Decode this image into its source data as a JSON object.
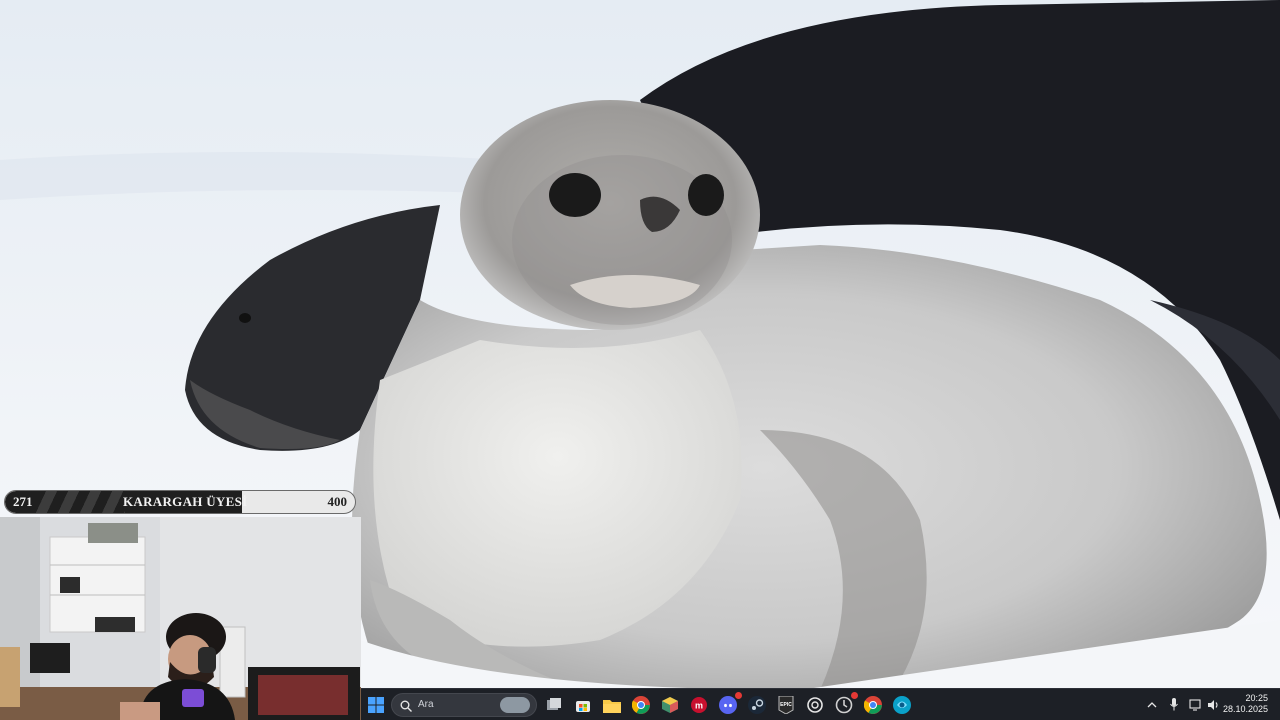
{
  "wallpaper": {
    "subject": "weddell-seal-pup-photo"
  },
  "goal_bar": {
    "current": "271",
    "title": "KARARGAH ÜYESİ",
    "target": "400",
    "progress_fraction": 0.6775
  },
  "webcam": {
    "subject": "streamer-webcam"
  },
  "taskbar": {
    "search_placeholder": "Ara",
    "apps": [
      "windows-start",
      "task-view",
      "microsoft-store",
      "file-explorer",
      "chrome",
      "app-cube",
      "meet",
      "discord",
      "steam",
      "epic-games",
      "chatgpt",
      "app-circle",
      "chrome-alt",
      "edge-copilot"
    ],
    "clock_time": "20:25",
    "clock_date": "28.10.2025"
  }
}
